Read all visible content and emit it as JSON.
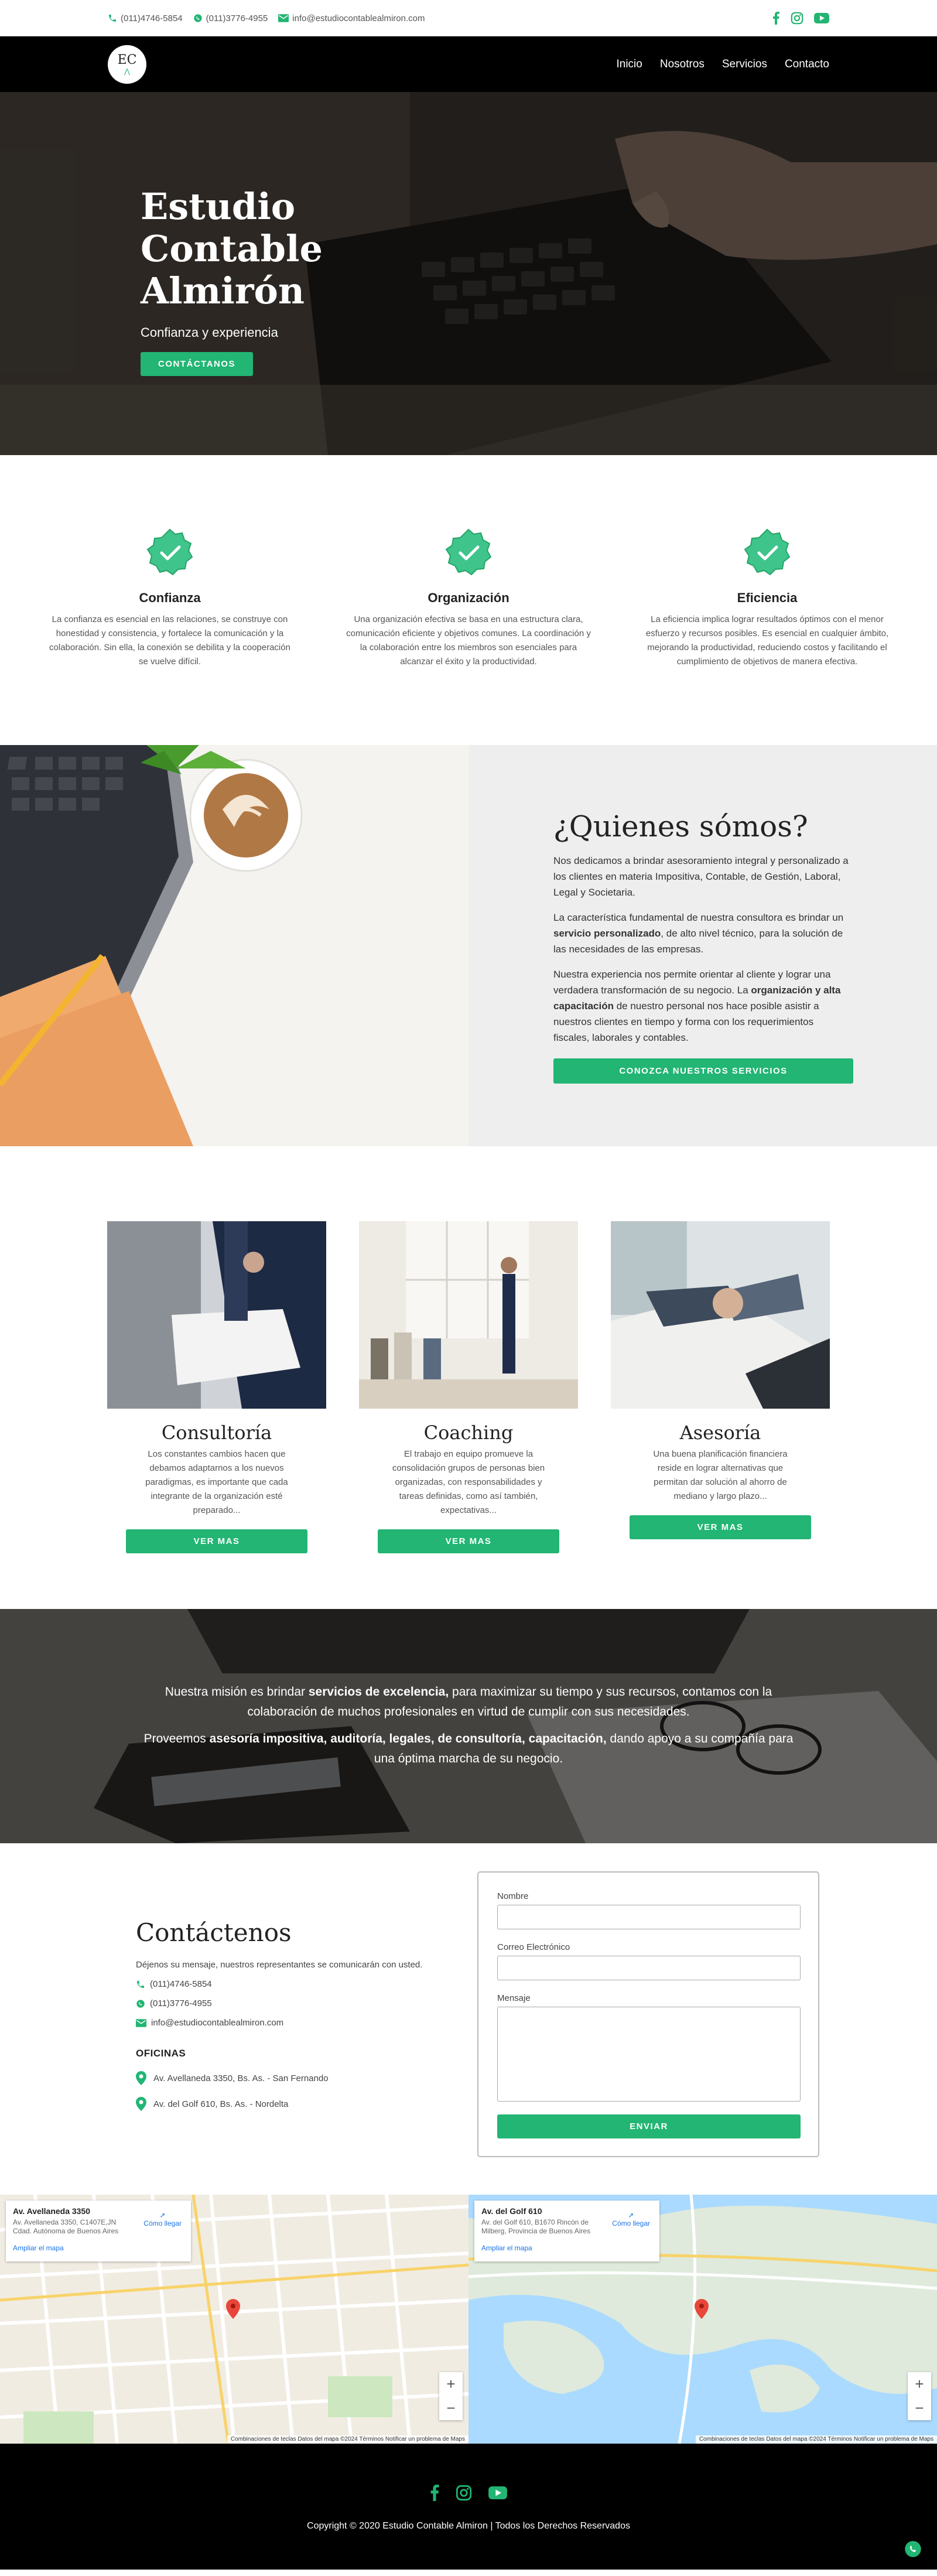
{
  "colors": {
    "accent": "#22b573",
    "nav_bg": "#000000",
    "about_bg": "#eeeeee"
  },
  "topbar": {
    "phone1": "(011)4746-5854",
    "phone2": "(011)3776-4955",
    "email": "info@estudiocontablealmiron.com",
    "social_icons": [
      "facebook-icon",
      "instagram-icon",
      "youtube-icon"
    ]
  },
  "nav": {
    "logo_text": "EC",
    "links": [
      "Inicio",
      "Nosotros",
      "Servicios",
      "Contacto"
    ]
  },
  "hero": {
    "title": "Estudio Contable Almirón",
    "tagline": "Confianza y experiencia",
    "button": "CONTÁCTANOS"
  },
  "values": [
    {
      "title": "Confianza",
      "text": "La confianza es esencial en las relaciones, se construye con honestidad y consistencia, y fortalece la comunicación y la colaboración. Sin ella, la conexión se debilita y la cooperación se vuelve difícil."
    },
    {
      "title": "Organización",
      "text": "Una organización efectiva se basa en una estructura clara, comunicación eficiente y objetivos comunes. La coordinación y la colaboración entre los miembros son esenciales para alcanzar el éxito y la productividad."
    },
    {
      "title": "Eficiencia",
      "text": "La eficiencia implica lograr resultados óptimos con el menor esfuerzo y recursos posibles. Es esencial en cualquier ámbito, mejorando la productividad, reduciendo costos y facilitando el cumplimiento de objetivos de manera efectiva."
    }
  ],
  "about": {
    "title": "¿Quienes sómos?",
    "p1": "Nos dedicamos a brindar asesoramiento integral y personalizado a los clientes en materia Impositiva, Contable, de Gestión, Laboral, Legal y Societaria.",
    "p2_a": "La característica fundamental de nuestra consultora es brindar un ",
    "p2_b": "servicio personalizado",
    "p2_c": ", de alto nivel técnico, para la solución de las necesidades de las empresas.",
    "p3_a": "Nuestra experiencia nos permite orientar al cliente y lograr una verdadera transformación de su negocio. La ",
    "p3_b": "organización y alta capacitación",
    "p3_c": " de nuestro personal nos hace posible asistir a nuestros clientes en tiempo y forma con los requerimientos fiscales, laborales y contables.",
    "button": "CONOZCA NUESTROS SERVICIOS"
  },
  "services": [
    {
      "title": "Consultoría",
      "text": "Los constantes cambios hacen que debamos adaptarnos a los nuevos paradigmas, es importante que cada integrante de la organización esté preparado...",
      "button": "VER MAS"
    },
    {
      "title": "Coaching",
      "text": "El trabajo en equipo promueve la consolidación grupos de personas bien organizadas, con responsabilidades y tareas definidas, como así también, expectativas...",
      "button": "VER MAS"
    },
    {
      "title": "Asesoría",
      "text": "Una buena planificación financiera reside en lograr alternativas que permitan dar solución al ahorro de mediano y largo plazo...",
      "button": "VER MAS"
    }
  ],
  "mission": {
    "p1_a": "Nuestra misión es brindar ",
    "p1_b": "servicios de excelencia,",
    "p1_c": " para maximizar su tiempo y sus recursos, contamos con la colaboración de muchos profesionales en virtud de cumplir con sus necesidades.",
    "p2_a": "Proveemos ",
    "p2_b": "asesoría impositiva, auditoría, legales, de consultoría, capacitación,",
    "p2_c": " dando apoyo a su compañía para una óptima marcha de su negocio."
  },
  "contact": {
    "title": "Contáctenos",
    "intro": "Déjenos su mensaje, nuestros representantes se comunicarán con usted.",
    "phone1": "(011)4746-5854",
    "phone2": "(011)3776-4955",
    "email": "info@estudiocontablealmiron.com",
    "offices_title": "OFICINAS",
    "office1": "Av. Avellaneda 3350, Bs. As. - San Fernando",
    "office2": "Av. del Golf 610, Bs. As. - Nordelta",
    "form": {
      "name_label": "Nombre",
      "email_label": "Correo Electrónico",
      "message_label": "Mensaje",
      "submit": "ENVIAR"
    }
  },
  "maps": [
    {
      "title": "Av. Avellaneda 3350",
      "address": "Av. Avellaneda 3350, C1407E,JN Cdad. Autónoma de Buenos Aires",
      "directions": "Cómo llegar",
      "enlarge": "Ampliar el mapa",
      "footer": "Combinaciones de teclas   Datos del mapa ©2024   Términos   Notificar un problema de Maps"
    },
    {
      "title": "Av. del Golf 610",
      "address": "Av. del Golf 610, B1670 Rincón de Milberg, Provincia de Buenos Aires",
      "directions": "Cómo llegar",
      "enlarge": "Ampliar el mapa",
      "footer": "Combinaciones de teclas   Datos del mapa ©2024   Términos   Notificar un problema de Maps"
    }
  ],
  "footer": {
    "copyright": "Copyright © 2020 Estudio Contable Almiron | Todos los Derechos Reservados"
  }
}
